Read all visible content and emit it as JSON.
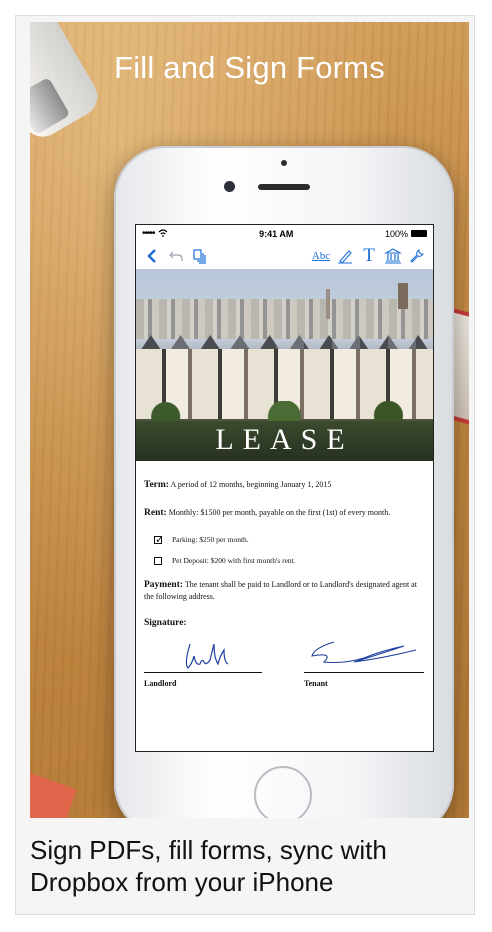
{
  "promo": {
    "title": "Fill and Sign Forms",
    "caption": "Sign PDFs, fill forms, sync with Dropbox from your iPhone"
  },
  "status_bar": {
    "carrier_dots": "•••••",
    "time": "9:41 AM",
    "battery": "100%"
  },
  "toolbar": {
    "back_icon": "chevron-left-icon",
    "undo_icon": "undo-icon",
    "pages_icon": "pages-icon",
    "text_annot_label": "Abc",
    "pen_icon": "pen-icon",
    "text_tool_label": "T",
    "stamp_icon": "bank-icon",
    "settings_icon": "wrench-icon",
    "accent": "#1a6fd8"
  },
  "document": {
    "hero_title": "LEASE",
    "term_label": "Term:",
    "term_text": "A period of 12 months, beginning January 1, 2015",
    "rent_label": "Rent:",
    "rent_text": "Monthly: $1500 per month, payable on the first (1st) of every month.",
    "options": [
      {
        "checked": true,
        "text": "Parking: $250 per month."
      },
      {
        "checked": false,
        "text": "Pet Deposit: $200 with first month's rent."
      }
    ],
    "payment_label": "Payment:",
    "payment_text": "The tenant shall be paid to Landlord or to Landlord's designated agent at the following address.",
    "signature_label": "Signature:",
    "landlord_label": "Landlord",
    "tenant_label": "Tenant"
  }
}
